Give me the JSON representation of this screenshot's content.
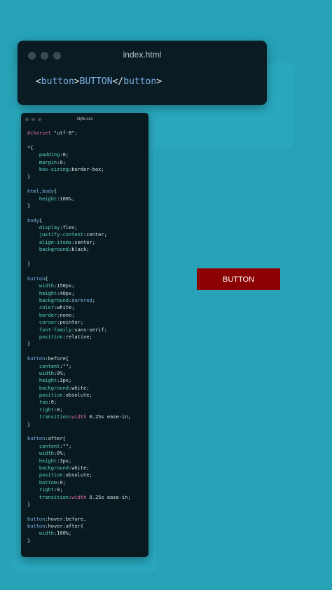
{
  "html_window": {
    "title": "index.html",
    "code": {
      "open_lt": "<",
      "open_tag": "button",
      "open_gt": ">",
      "text": "BUTTON",
      "close_lt": "</",
      "close_tag": "button",
      "close_gt": ">"
    }
  },
  "css_window": {
    "title": "style.css",
    "lines": [
      [
        {
          "t": "@charset",
          "c": "kw"
        },
        {
          "t": " \"utf-8\";",
          "c": "str"
        }
      ],
      [],
      [
        {
          "t": "*{",
          "c": "p"
        }
      ],
      [
        {
          "t": "    padding",
          "c": "prop"
        },
        {
          "t": ":0;",
          "c": "val"
        }
      ],
      [
        {
          "t": "    margin",
          "c": "prop"
        },
        {
          "t": ":0;",
          "c": "val"
        }
      ],
      [
        {
          "t": "    box-sizing",
          "c": "prop"
        },
        {
          "t": ":border-box;",
          "c": "val"
        }
      ],
      [
        {
          "t": "}",
          "c": "p"
        }
      ],
      [],
      [
        {
          "t": "html,body",
          "c": "sel"
        },
        {
          "t": "{",
          "c": "p"
        }
      ],
      [
        {
          "t": "    height",
          "c": "prop"
        },
        {
          "t": ":100%;",
          "c": "val"
        }
      ],
      [
        {
          "t": "}",
          "c": "p"
        }
      ],
      [],
      [
        {
          "t": "body",
          "c": "sel"
        },
        {
          "t": "{",
          "c": "p"
        }
      ],
      [
        {
          "t": "    display",
          "c": "prop"
        },
        {
          "t": ":flex;",
          "c": "val"
        }
      ],
      [
        {
          "t": "    justify-content",
          "c": "prop"
        },
        {
          "t": ":center;",
          "c": "val"
        }
      ],
      [
        {
          "t": "    align-items",
          "c": "prop"
        },
        {
          "t": ":center;",
          "c": "val"
        }
      ],
      [
        {
          "t": "    background",
          "c": "prop"
        },
        {
          "t": ":black;",
          "c": "val"
        }
      ],
      [],
      [
        {
          "t": "}",
          "c": "p"
        }
      ],
      [],
      [
        {
          "t": "button",
          "c": "sel"
        },
        {
          "t": "{",
          "c": "p"
        }
      ],
      [
        {
          "t": "    width",
          "c": "prop"
        },
        {
          "t": ":150px;",
          "c": "val"
        }
      ],
      [
        {
          "t": "    height",
          "c": "prop"
        },
        {
          "t": ":40px;",
          "c": "val"
        }
      ],
      [
        {
          "t": "    background",
          "c": "prop"
        },
        {
          "t": ":",
          "c": "val"
        },
        {
          "t": "darkred",
          "c": "sel"
        },
        {
          "t": ";",
          "c": "val"
        }
      ],
      [
        {
          "t": "    color",
          "c": "prop"
        },
        {
          "t": ":white;",
          "c": "val"
        }
      ],
      [
        {
          "t": "    border",
          "c": "prop"
        },
        {
          "t": ":none;",
          "c": "val"
        }
      ],
      [
        {
          "t": "    cursor",
          "c": "prop"
        },
        {
          "t": ":pointer;",
          "c": "val"
        }
      ],
      [
        {
          "t": "    font-family",
          "c": "prop"
        },
        {
          "t": ":sans-serif;",
          "c": "val"
        }
      ],
      [
        {
          "t": "    position",
          "c": "prop"
        },
        {
          "t": ":relative;",
          "c": "val"
        }
      ],
      [
        {
          "t": "}",
          "c": "p"
        }
      ],
      [],
      [
        {
          "t": "button",
          "c": "sel"
        },
        {
          "t": ":before{",
          "c": "p"
        }
      ],
      [
        {
          "t": "    content",
          "c": "prop"
        },
        {
          "t": ":\"\";",
          "c": "val"
        }
      ],
      [
        {
          "t": "    width",
          "c": "prop"
        },
        {
          "t": ":0%;",
          "c": "val"
        }
      ],
      [
        {
          "t": "    height",
          "c": "prop"
        },
        {
          "t": ":3px;",
          "c": "val"
        }
      ],
      [
        {
          "t": "    background",
          "c": "prop"
        },
        {
          "t": ":white;",
          "c": "val"
        }
      ],
      [
        {
          "t": "    position",
          "c": "prop"
        },
        {
          "t": ":absolute;",
          "c": "val"
        }
      ],
      [
        {
          "t": "    top",
          "c": "prop"
        },
        {
          "t": ":0;",
          "c": "val"
        }
      ],
      [
        {
          "t": "    right",
          "c": "prop"
        },
        {
          "t": ":0;",
          "c": "val"
        }
      ],
      [
        {
          "t": "    transition",
          "c": "prop"
        },
        {
          "t": ":",
          "c": "val"
        },
        {
          "t": "width",
          "c": "kw"
        },
        {
          "t": " 0.25s ease-in;",
          "c": "val"
        }
      ],
      [
        {
          "t": "}",
          "c": "p"
        }
      ],
      [],
      [
        {
          "t": "button",
          "c": "sel"
        },
        {
          "t": ":after{",
          "c": "p"
        }
      ],
      [
        {
          "t": "    content",
          "c": "prop"
        },
        {
          "t": ":\"\";",
          "c": "val"
        }
      ],
      [
        {
          "t": "    width",
          "c": "prop"
        },
        {
          "t": ":0%;",
          "c": "val"
        }
      ],
      [
        {
          "t": "    height",
          "c": "prop"
        },
        {
          "t": ":3px;",
          "c": "val"
        }
      ],
      [
        {
          "t": "    background",
          "c": "prop"
        },
        {
          "t": ":white;",
          "c": "val"
        }
      ],
      [
        {
          "t": "    position",
          "c": "prop"
        },
        {
          "t": ":absolute;",
          "c": "val"
        }
      ],
      [
        {
          "t": "    bottom",
          "c": "prop"
        },
        {
          "t": ":0;",
          "c": "val"
        }
      ],
      [
        {
          "t": "    right",
          "c": "prop"
        },
        {
          "t": ":0;",
          "c": "val"
        }
      ],
      [
        {
          "t": "    transition",
          "c": "prop"
        },
        {
          "t": ":",
          "c": "val"
        },
        {
          "t": "width",
          "c": "kw"
        },
        {
          "t": " 0.25s ease-in;",
          "c": "val"
        }
      ],
      [
        {
          "t": "}",
          "c": "p"
        }
      ],
      [],
      [
        {
          "t": "button",
          "c": "sel"
        },
        {
          "t": ":hover:before,",
          "c": "p"
        }
      ],
      [
        {
          "t": "button",
          "c": "sel"
        },
        {
          "t": ":hover:after{",
          "c": "p"
        }
      ],
      [
        {
          "t": "    width",
          "c": "prop"
        },
        {
          "t": ":100%;",
          "c": "val"
        }
      ],
      [
        {
          "t": "}",
          "c": "p"
        }
      ]
    ]
  },
  "demo_button": {
    "label": "BUTTON"
  },
  "colors": {
    "background": "#27a2b7",
    "editor": "#081a20",
    "button": "#8b0000"
  }
}
